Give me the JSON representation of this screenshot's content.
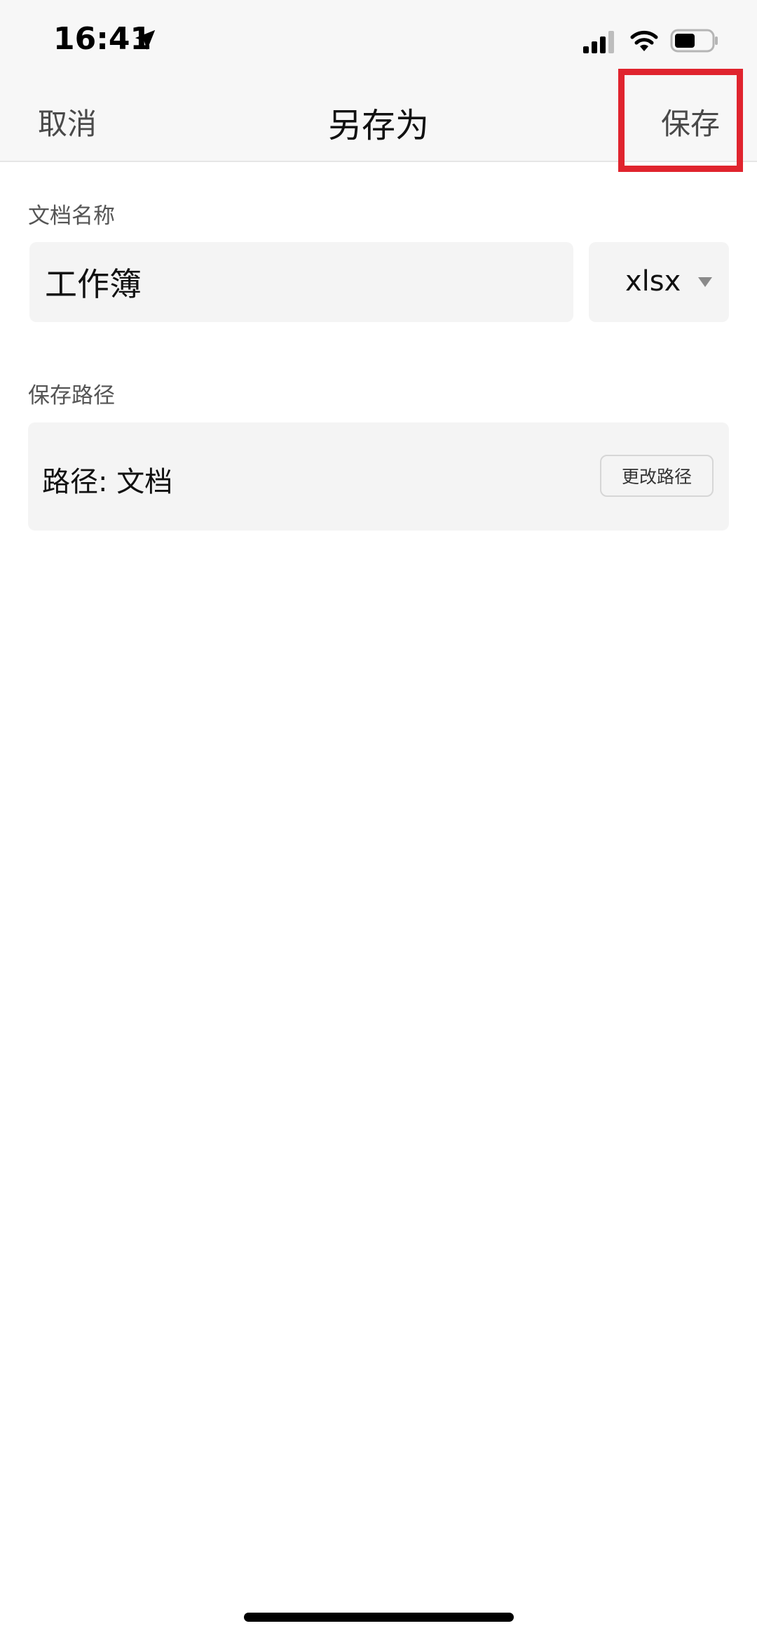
{
  "status_bar": {
    "time": "16:41",
    "icons": [
      "location-arrow-icon",
      "cellular-signal-icon",
      "wifi-icon",
      "battery-icon"
    ]
  },
  "nav": {
    "cancel_label": "取消",
    "title": "另存为",
    "save_label": "保存"
  },
  "document_name": {
    "label": "文档名称",
    "value": "工作簿",
    "extension": "xlsx"
  },
  "save_path": {
    "label": "保存路径",
    "path_text": "路径: 文档",
    "change_label": "更改路径"
  },
  "colors": {
    "highlight": "#e0242e",
    "field_bg": "#f4f4f4",
    "nav_bg": "#f7f7f7"
  }
}
